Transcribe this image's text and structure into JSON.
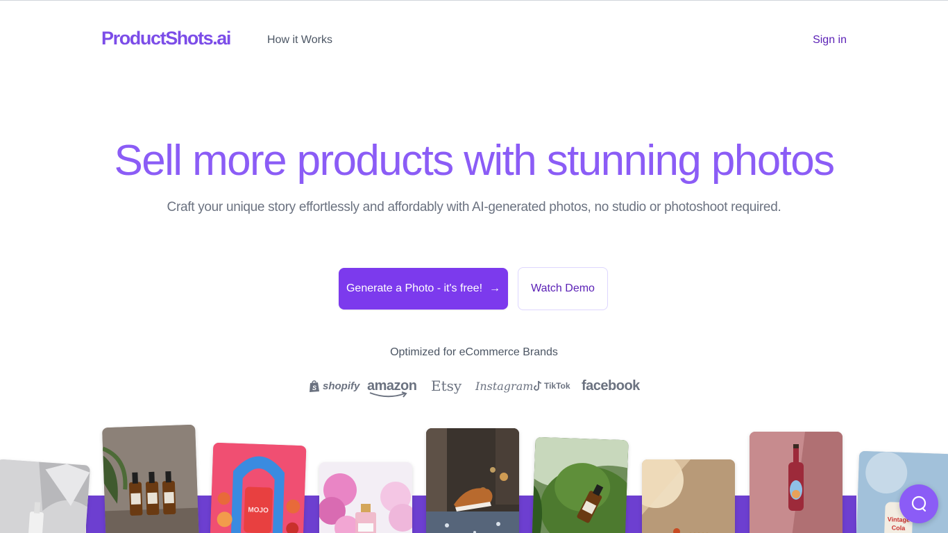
{
  "header": {
    "logo_text": "ProductShots.ai",
    "nav_link": "How it Works",
    "signin_label": "Sign in"
  },
  "hero": {
    "title": "Sell more products with stunning photos",
    "subtitle": "Craft your unique story effortlessly and affordably with AI-generated photos, no studio or photoshoot required.",
    "primary_cta": "Generate a Photo - it's free!",
    "primary_cta_icon": "arrow-right-icon",
    "secondary_cta": "Watch Demo"
  },
  "brands": {
    "caption": "Optimized for eCommerce Brands",
    "items": [
      "shopify",
      "amazon",
      "Etsy",
      "Instagram",
      "TikTok",
      "facebook"
    ]
  },
  "gallery": {
    "product_photos": [
      "serum-bottle",
      "amber-bottles",
      "mojo-pouch",
      "perfume-bottle",
      "sneaker",
      "moss-bottle",
      "sunlit-product",
      "wine-bottle",
      "vintage-can"
    ]
  },
  "chat": {
    "icon": "chat-bubble-icon"
  },
  "colors": {
    "brand_purple": "#7c3aed",
    "title_purple": "#8b5cf6",
    "strip_purple": "#6d3fd0"
  }
}
